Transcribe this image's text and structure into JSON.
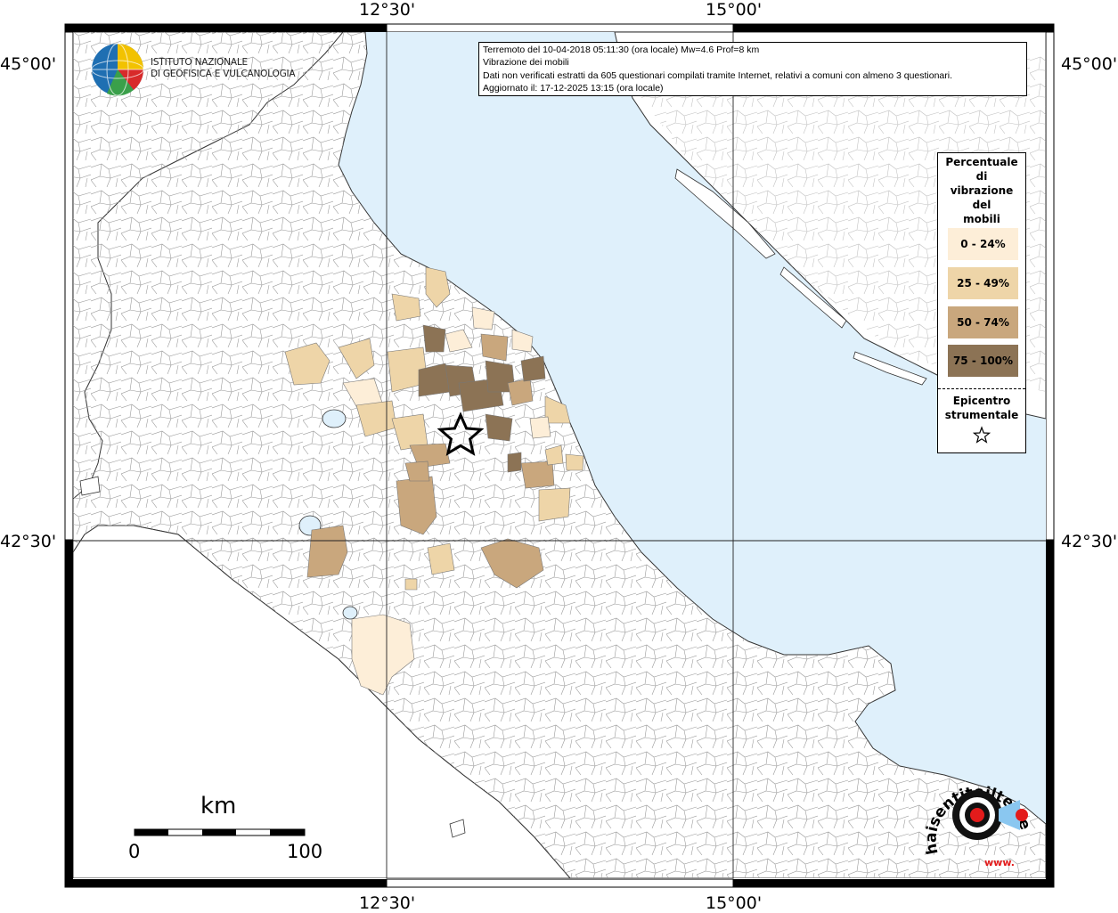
{
  "header": {
    "line1": "Terremoto del 10-04-2018 05:11:30 (ora locale) Mw=4.6 Prof=8 km",
    "line2": "Vibrazione dei mobili",
    "line3": "Dati non verificati estratti da 605 questionari compilati tramite Internet, relativi a comuni con almeno 3 questionari.",
    "line4": "Aggiornato il: 17-12-2025 13:15 (ora locale)"
  },
  "institute": {
    "line1": "ISTITUTO NAZIONALE",
    "line2": "DI GEOFISICA E VULCANOLOGIA"
  },
  "axes": {
    "lon_left": "12°30'",
    "lon_right": "15°00'",
    "lat_top": "45°00'",
    "lat_bottom": "42°30'"
  },
  "legend": {
    "title_lines": [
      "Percentuale",
      "di",
      "vibrazione",
      "del",
      "mobili"
    ],
    "items": [
      {
        "label": "0 - 24%",
        "color": "#fdeed8"
      },
      {
        "label": "25 - 49%",
        "color": "#eed5a8"
      },
      {
        "label": "50 - 74%",
        "color": "#c9a77d"
      },
      {
        "label": "75 - 100%",
        "color": "#8c7355"
      }
    ],
    "epicenter_lines": [
      "Epicentro",
      "strumentale"
    ]
  },
  "scale": {
    "unit": "km",
    "start": "0",
    "end": "100"
  },
  "watermark": {
    "brand": "haisentitoilterremoto.it",
    "url_prefix": "www."
  },
  "colors": {
    "sea": "#dff0fb",
    "land": "#ffffff",
    "grid": "#222222"
  }
}
